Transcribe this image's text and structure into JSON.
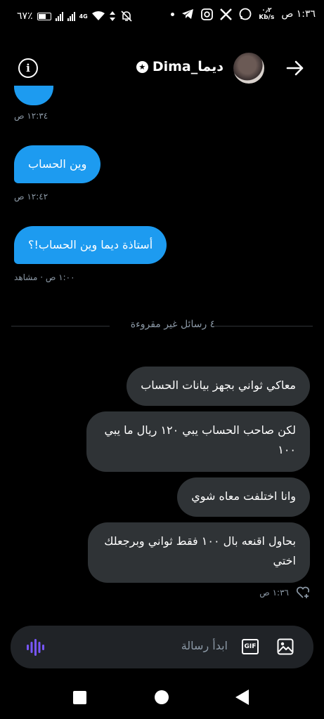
{
  "status_bar": {
    "time": "١:٣٦ ص",
    "speed_value": "٠٫٢",
    "speed_unit": "Kb/s",
    "battery_percent": "٦٧٪",
    "network": "4G"
  },
  "header": {
    "username": "Dima_ديما"
  },
  "messages_top": [
    {
      "time": "١٢:٣٤ ص"
    },
    {
      "text": "وين الحساب",
      "time": "١٢:٤٢ ص"
    },
    {
      "text": "أستاذة ديما وين الحساب!؟",
      "time": "١:٠٠ ص · مشاهد"
    }
  ],
  "unread_divider": "٤ رسائل غير مقروءة",
  "messages_out": [
    {
      "text": "معاكي ثواني بجهز بيانات الحساب"
    },
    {
      "text": "لكن صاحب الحساب يبي ١٢٠ ريال ما يبي ١٠٠"
    },
    {
      "text": "وانا اختلفت معاه شوي"
    },
    {
      "text": "بحاول اقنعه بال ١٠٠ فقط ثواني وبرجعلك اختي"
    }
  ],
  "last_time": "١:٣٦ ص",
  "composer": {
    "placeholder": "ابدأ رسالة",
    "gif_label": "GIF"
  },
  "colors": {
    "incoming_bubble": "#1d9bf0",
    "outgoing_bubble": "#2f3336",
    "background": "#000000",
    "voice_accent": "#7856ff"
  }
}
